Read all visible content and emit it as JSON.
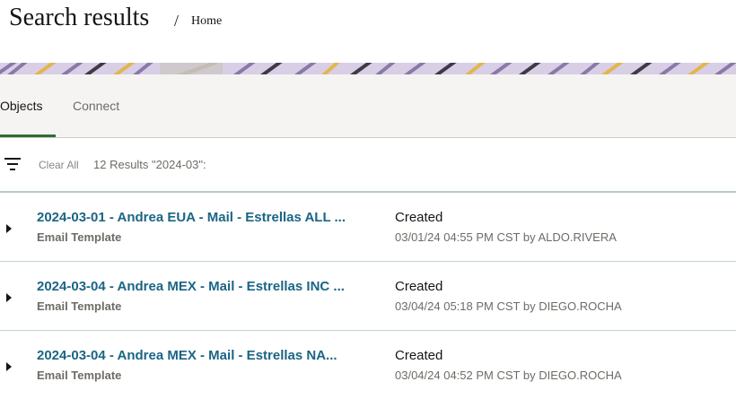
{
  "header": {
    "title": "Search results",
    "separator": "/",
    "breadcrumb": "Home"
  },
  "tabs": [
    {
      "label": "Objects",
      "active": true
    },
    {
      "label": "Connect",
      "active": false
    }
  ],
  "toolbar": {
    "clear_all": "Clear All",
    "results": "12 Results \"2024-03\":"
  },
  "results": [
    {
      "title": "2024-03-01 - Andrea EUA - Mail - Estrellas ALL ...",
      "type": "Email Template",
      "status": "Created",
      "meta": "03/01/24 04:55 PM CST by ALDO.RIVERA"
    },
    {
      "title": "2024-03-04 - Andrea MEX - Mail - Estrellas INC ...",
      "type": "Email Template",
      "status": "Created",
      "meta": "03/04/24 05:18 PM CST by DIEGO.ROCHA"
    },
    {
      "title": "2024-03-04 - Andrea MEX - Mail - Estrellas NA...",
      "type": "Email Template",
      "status": "Created",
      "meta": "03/04/24 04:52 PM CST by DIEGO.ROCHA"
    }
  ],
  "icons": {
    "filter": "filter-icon",
    "expand": "caret-right-icon"
  },
  "colors": {
    "link": "#1b6585",
    "tab_underline": "#2f6b34",
    "tabbar_bg": "#f5f4f2",
    "banner_purple": "#8a78a8",
    "banner_lilac": "#d8cfe6",
    "banner_gold": "#e3b64a"
  }
}
